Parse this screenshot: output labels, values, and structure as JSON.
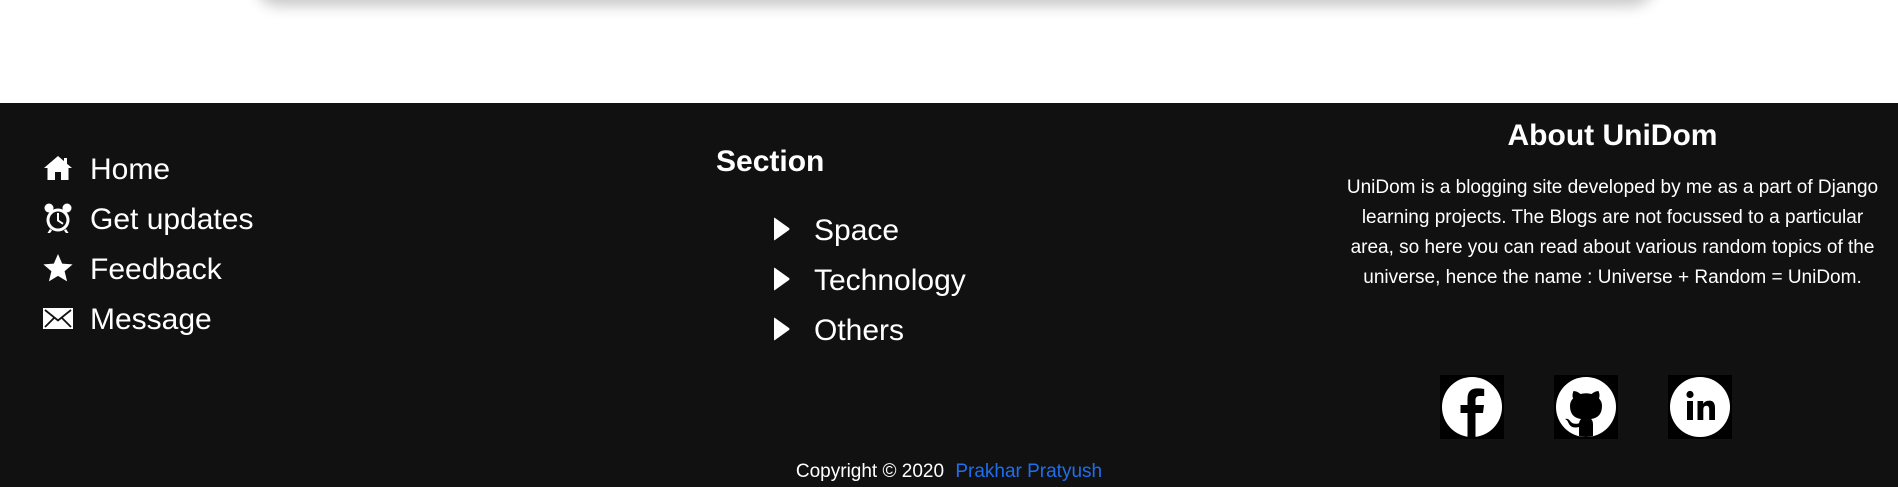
{
  "footer": {
    "nav": [
      {
        "label": "Home",
        "icon": "home-icon"
      },
      {
        "label": "Get updates",
        "icon": "alarm-clock-icon"
      },
      {
        "label": "Feedback",
        "icon": "star-icon"
      },
      {
        "label": "Message",
        "icon": "envelope-icon"
      }
    ],
    "section": {
      "title": "Section",
      "items": [
        {
          "label": "Space",
          "icon": "caret-right-icon"
        },
        {
          "label": "Technology",
          "icon": "caret-right-icon"
        },
        {
          "label": "Others",
          "icon": "caret-right-icon"
        }
      ]
    },
    "about": {
      "title": "About UniDom",
      "text": "UniDom is a blogging site developed by me as a part of Django learning projects. The Blogs are not focussed to a particular area, so here you can read about various random topics of the universe, hence the name : Universe + Random = UniDom."
    },
    "social": [
      {
        "icon": "facebook-icon"
      },
      {
        "icon": "github-icon"
      },
      {
        "icon": "linkedin-icon"
      }
    ],
    "copyright": {
      "text": "Copyright © 2020",
      "author": "Prakhar Pratyush"
    }
  },
  "colors": {
    "footer_bg": "#111111",
    "link": "#1e6ef0",
    "text": "#ffffff"
  }
}
